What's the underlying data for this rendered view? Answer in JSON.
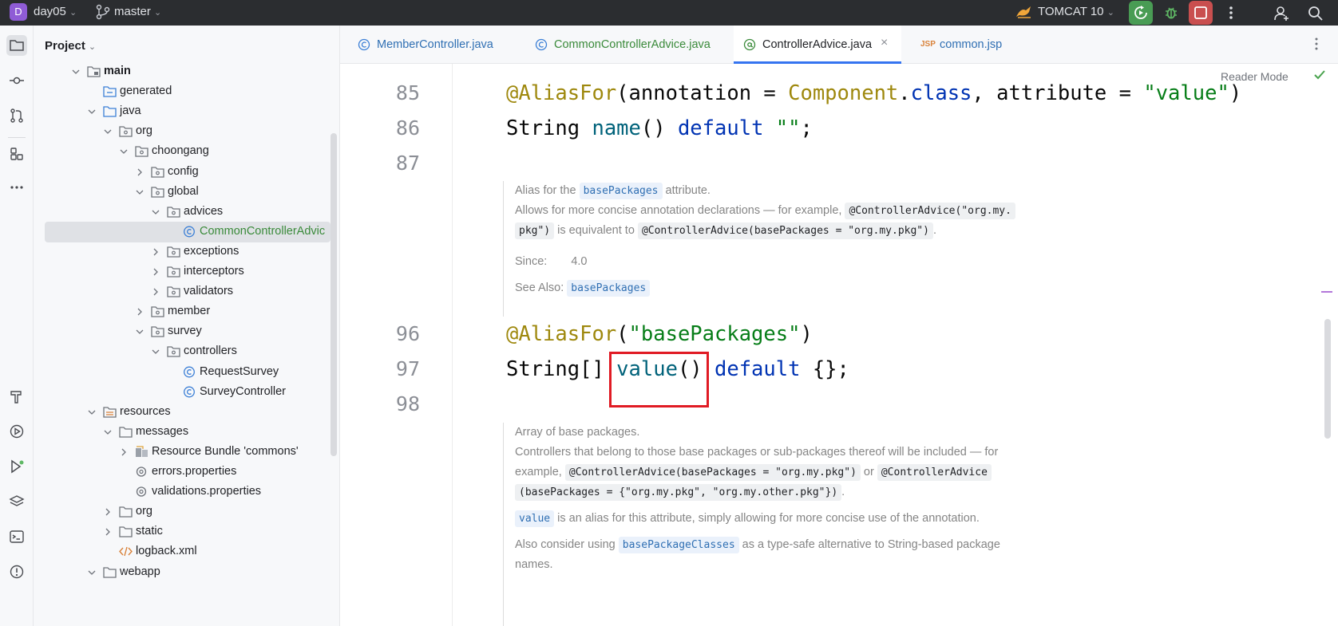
{
  "titlebar": {
    "project_badge": "D",
    "project_name": "day05",
    "branch_name": "master",
    "run_config": "TOMCAT 10"
  },
  "project_panel": {
    "header": "Project",
    "tree": [
      {
        "label": "main",
        "bold": true
      },
      {
        "label": "generated"
      },
      {
        "label": "java"
      },
      {
        "label": "org"
      },
      {
        "label": "choongang"
      },
      {
        "label": "config"
      },
      {
        "label": "global"
      },
      {
        "label": "advices"
      },
      {
        "label": "CommonControllerAdvic",
        "selected": true
      },
      {
        "label": "exceptions"
      },
      {
        "label": "interceptors"
      },
      {
        "label": "validators"
      },
      {
        "label": "member"
      },
      {
        "label": "survey"
      },
      {
        "label": "controllers"
      },
      {
        "label": "RequestSurvey"
      },
      {
        "label": "SurveyController"
      },
      {
        "label": "resources"
      },
      {
        "label": "messages"
      },
      {
        "label": "Resource Bundle 'commons'"
      },
      {
        "label": "errors.properties"
      },
      {
        "label": "validations.properties"
      },
      {
        "label": "org"
      },
      {
        "label": "static"
      },
      {
        "label": "logback.xml"
      },
      {
        "label": "webapp"
      }
    ]
  },
  "tabs": [
    {
      "label": "MemberController.java"
    },
    {
      "label": "CommonControllerAdvice.java"
    },
    {
      "label": "ControllerAdvice.java",
      "active": true
    },
    {
      "label": "common.jsp"
    }
  ],
  "editor": {
    "reader_mode": "Reader Mode",
    "line_numbers": {
      "l85": "85",
      "l86": "86",
      "l87": "87",
      "l96": "96",
      "l97": "97",
      "l98": "98"
    },
    "code": {
      "l85_ann": "@AliasFor",
      "l85_p1": "(annotation = ",
      "l85_cls": "Component",
      "l85_dot": ".",
      "l85_kw": "class",
      "l85_p2": ", attribute = ",
      "l85_str": "\"value\"",
      "l85_p3": ")",
      "l86_type": "String ",
      "l86_meth": "name",
      "l86_p1": "() ",
      "l86_kw": "default",
      "l86_str": " \"\"",
      "l86_p2": ";",
      "l96_ann": "@AliasFor",
      "l96_p1": "(",
      "l96_str": "\"basePackages\"",
      "l96_p2": ")",
      "l97_type": "String[] ",
      "l97_meth": "value",
      "l97_p1": "() ",
      "l97_kw": "default",
      "l97_p2": " {};"
    },
    "doc1": {
      "line1_a": "Alias for the ",
      "line1_chip": "basePackages",
      "line1_b": " attribute.",
      "line2_a": "Allows for more concise annotation declarations — for example, ",
      "line2_chip1": "@ControllerAdvice(\"org.my.",
      "line2_chip1b": "pkg\")",
      "line2_b": " is equivalent to ",
      "line2_chip2": "@ControllerAdvice(basePackages = \"org.my.pkg\")",
      "line2_c": ".",
      "since_label": "Since:",
      "since_value": "4.0",
      "see_also_label": "See Also:",
      "see_also_chip": "basePackages"
    },
    "doc2": {
      "line1": "Array of base packages.",
      "line2_a": "Controllers that belong to those base packages or sub-packages thereof will be included — for example, ",
      "line2_chip1": "@ControllerAdvice(basePackages = \"org.my.pkg\")",
      "line2_b": " or ",
      "line2_chip2": "@ControllerAdvice",
      "line2_chip3": "(basePackages = {\"org.my.pkg\", \"org.my.other.pkg\"})",
      "line2_c": ".",
      "line3_chip": "value",
      "line3_b": " is an alias for this attribute, simply allowing for more concise use of the annotation.",
      "line4_a": "Also consider using ",
      "line4_chip": "basePackageClasses",
      "line4_b": " as a type-safe alternative to String-based package names."
    }
  },
  "colors": {
    "accent": "#3574f0",
    "highlight_box": "#e01b24",
    "run_button": "#499c54",
    "stop_button": "#c94f4f"
  },
  "icons": [
    "project-badge",
    "branch-icon",
    "tomcat-icon",
    "run-icon",
    "debug-icon",
    "stop-icon",
    "more-icon",
    "add-user-icon",
    "search-icon",
    "folder-icon",
    "package-icon",
    "class-icon",
    "properties-icon",
    "xml-icon",
    "annotation-icon",
    "jsp-icon",
    "close-icon",
    "check-icon"
  ]
}
